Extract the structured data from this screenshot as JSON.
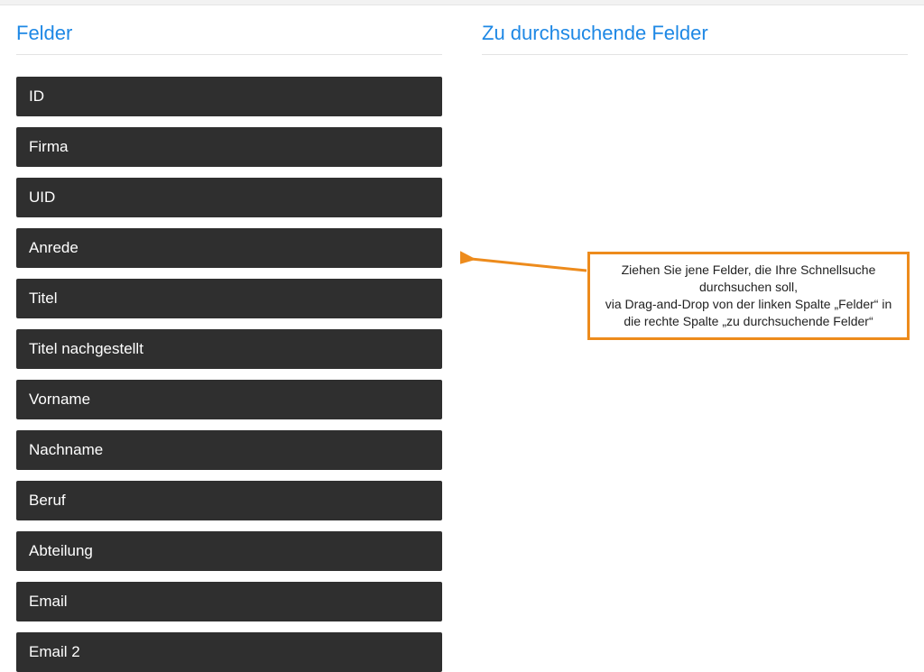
{
  "colors": {
    "accent": "#1e88e5",
    "field_bg": "#2f2f2f",
    "annotation_border": "#ed8b1c"
  },
  "left_column": {
    "title": "Felder",
    "items": [
      "ID",
      "Firma",
      "UID",
      "Anrede",
      "Titel",
      "Titel nachgestellt",
      "Vorname",
      "Nachname",
      "Beruf",
      "Abteilung",
      "Email",
      "Email 2"
    ]
  },
  "right_column": {
    "title": "Zu durchsuchende Felder"
  },
  "annotation": {
    "line1": "Ziehen Sie jene Felder, die Ihre Schnellsuche durchsuchen soll,",
    "line2": "via Drag-and-Drop von der linken Spalte „Felder“ in die rechte Spalte „zu durchsuchende Felder“"
  }
}
